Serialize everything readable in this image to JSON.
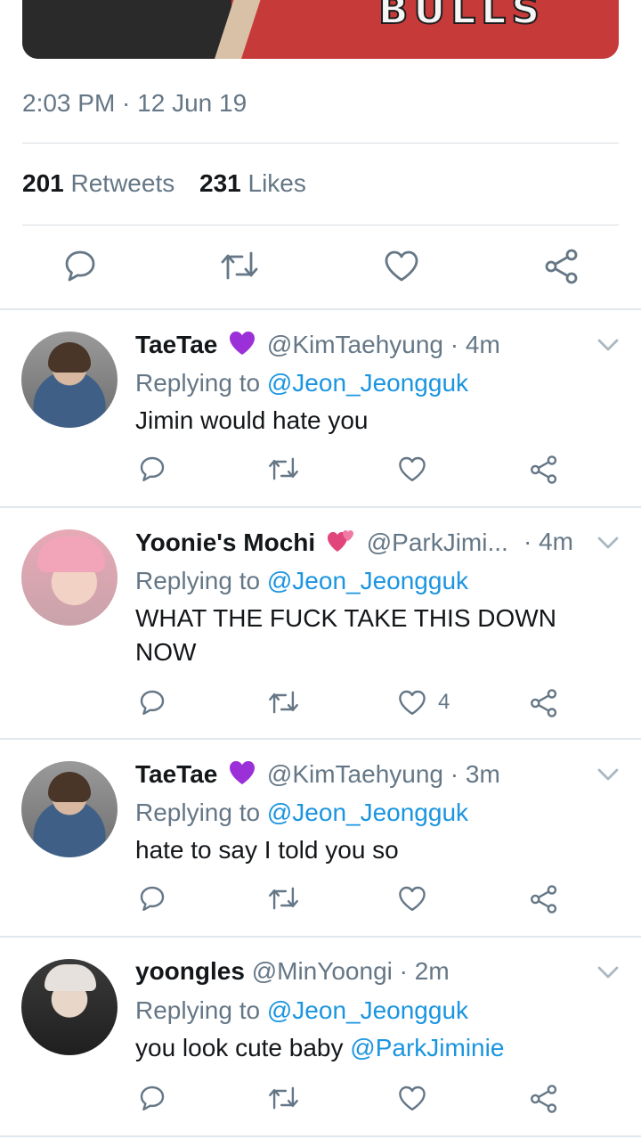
{
  "tweet": {
    "timestamp": "2:03 PM · 12 Jun 19",
    "retweets_count": "201",
    "retweets_label": "Retweets",
    "likes_count": "231",
    "likes_label": "Likes",
    "image_text": "BULLS"
  },
  "icons": {
    "reply": "reply-icon",
    "retweet": "retweet-icon",
    "like": "heart-icon",
    "share": "share-icon",
    "more": "chevron-down-icon"
  },
  "colors": {
    "accent": "#1b95e0",
    "muted": "#657786",
    "text": "#14171a",
    "purple_heart": "#9b30d9",
    "pink_heart": "#e0457b"
  },
  "replies": [
    {
      "name": "TaeTae",
      "emoji": "purple-heart",
      "handle_time": "@KimTaehyung · 4m",
      "replying_label": "Replying to",
      "replying_to": "@Jeon_Jeongguk",
      "text": "Jimin would hate you",
      "likes": ""
    },
    {
      "name": "Yoonie's Mochi",
      "emoji": "two-hearts",
      "handle": "@ParkJimi...",
      "time": "· 4m",
      "replying_label": "Replying to",
      "replying_to": "@Jeon_Jeongguk",
      "text": "WHAT THE FUCK TAKE THIS DOWN NOW",
      "likes": "4"
    },
    {
      "name": "TaeTae",
      "emoji": "purple-heart",
      "handle_time": "@KimTaehyung · 3m",
      "replying_label": "Replying to",
      "replying_to": "@Jeon_Jeongguk",
      "text": "hate to say I told you so",
      "likes": ""
    },
    {
      "name": "yoongles",
      "handle_time": "@MinYoongi · 2m",
      "replying_label": "Replying to",
      "replying_to": "@Jeon_Jeongguk",
      "text": "you look cute baby",
      "text_mention": "@ParkJiminie",
      "likes": ""
    }
  ]
}
